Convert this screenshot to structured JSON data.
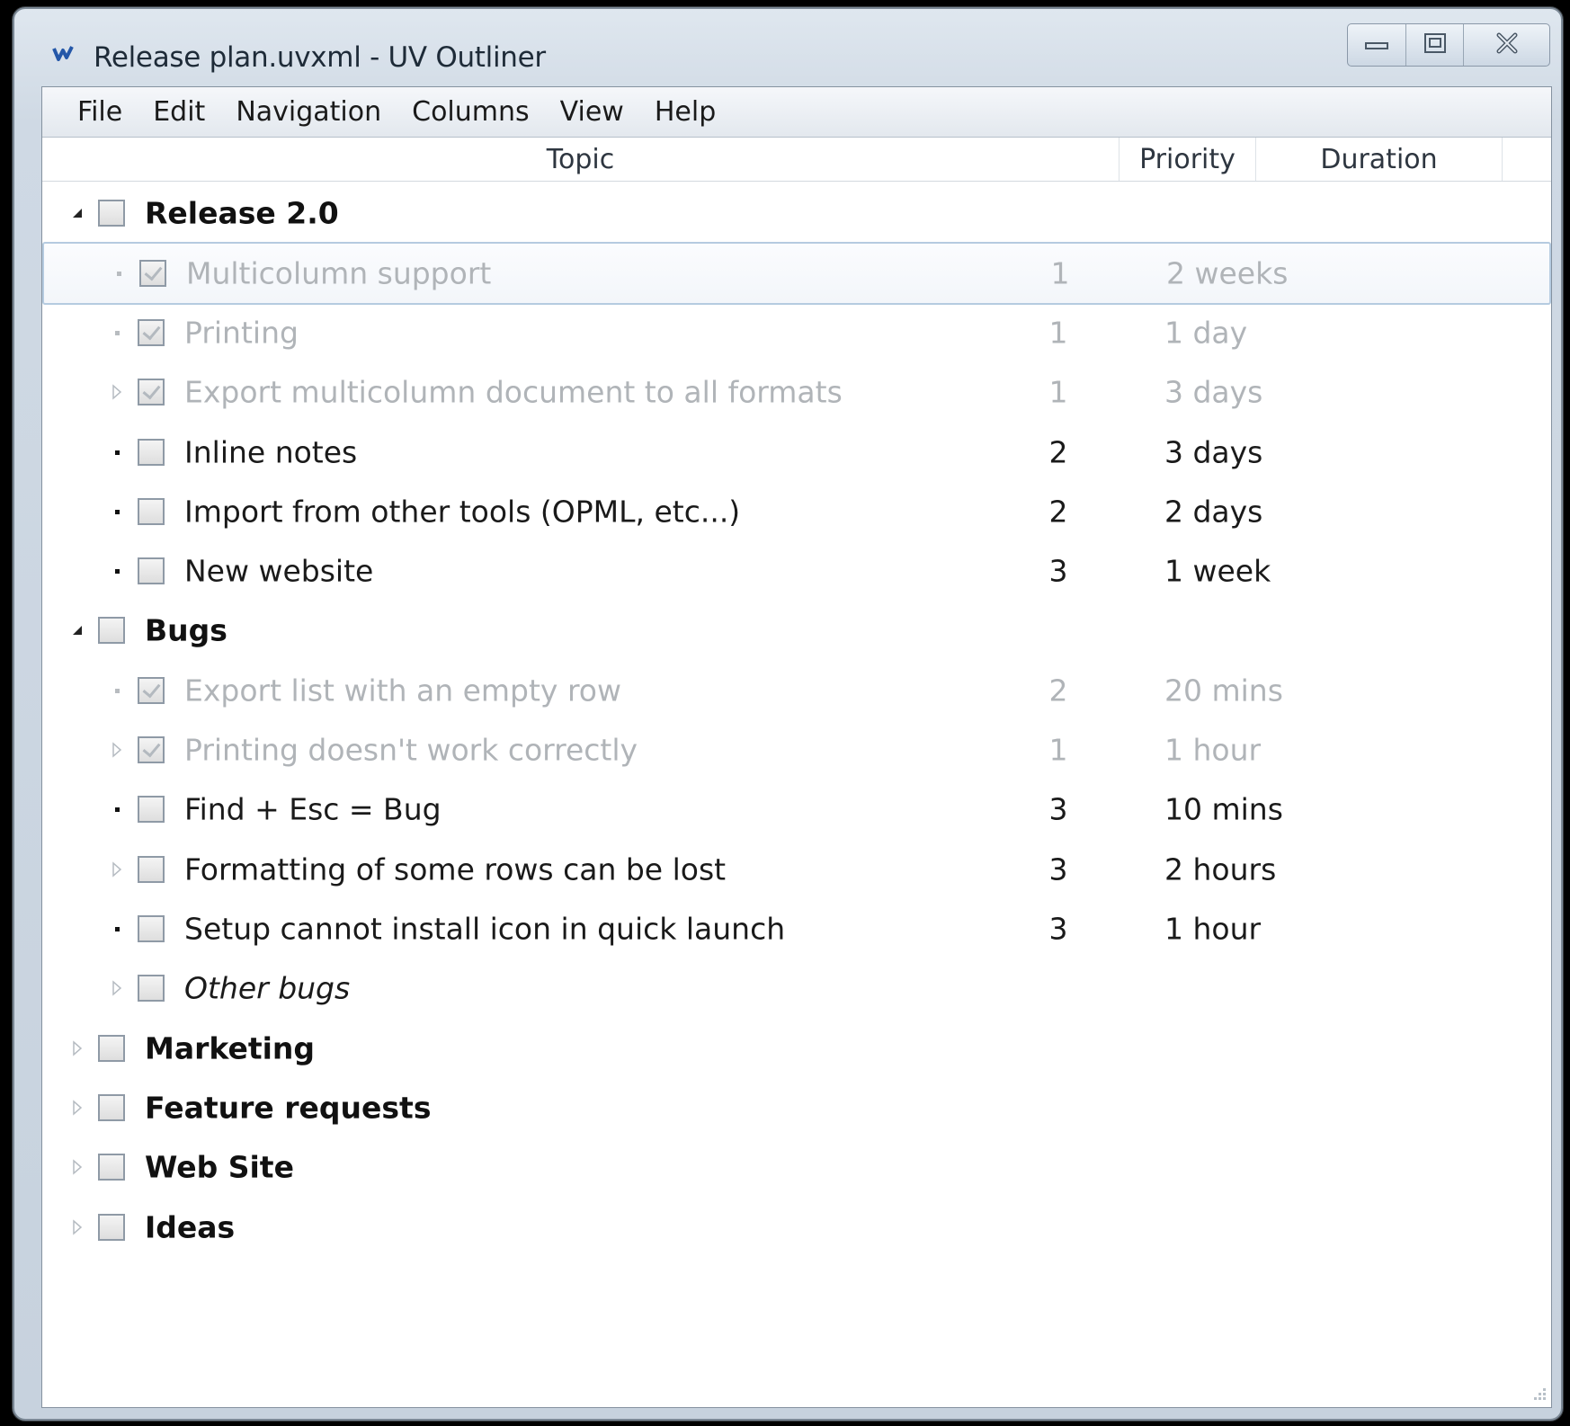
{
  "window": {
    "title": "Release plan.uvxml - UV Outliner"
  },
  "menu": [
    "File",
    "Edit",
    "Navigation",
    "Columns",
    "View",
    "Help"
  ],
  "columns": {
    "topic": "Topic",
    "priority": "Priority",
    "duration": "Duration"
  },
  "rows": [
    {
      "topic": "Release 2.0",
      "priority": "",
      "duration": "",
      "level": 0,
      "expander": "expanded",
      "checked": false,
      "style": "bold"
    },
    {
      "topic": "Multicolumn support",
      "priority": "1",
      "duration": "2 weeks",
      "level": 1,
      "expander": "bullet",
      "checked": true,
      "style": "done",
      "selected": true
    },
    {
      "topic": "Printing",
      "priority": "1",
      "duration": "1 day",
      "level": 1,
      "expander": "bullet",
      "checked": true,
      "style": "done"
    },
    {
      "topic": "Export multicolumn document to all formats",
      "priority": "1",
      "duration": "3 days",
      "level": 1,
      "expander": "collapsed",
      "checked": true,
      "style": "done"
    },
    {
      "topic": "Inline notes",
      "priority": "2",
      "duration": "3 days",
      "level": 1,
      "expander": "bullet",
      "checked": false,
      "style": "normal"
    },
    {
      "topic": "Import from other tools (OPML, etc...)",
      "priority": "2",
      "duration": "2 days",
      "level": 1,
      "expander": "bullet",
      "checked": false,
      "style": "normal"
    },
    {
      "topic": "New website",
      "priority": "3",
      "duration": "1 week",
      "level": 1,
      "expander": "bullet",
      "checked": false,
      "style": "normal"
    },
    {
      "topic": "Bugs",
      "priority": "",
      "duration": "",
      "level": 0,
      "expander": "expanded",
      "checked": false,
      "style": "bold"
    },
    {
      "topic": "Export list with an empty row",
      "priority": "2",
      "duration": "20 mins",
      "level": 1,
      "expander": "bullet",
      "checked": true,
      "style": "done"
    },
    {
      "topic": "Printing doesn't work correctly",
      "priority": "1",
      "duration": "1 hour",
      "level": 1,
      "expander": "collapsed",
      "checked": true,
      "style": "done"
    },
    {
      "topic": "Find + Esc = Bug",
      "priority": "3",
      "duration": "10 mins",
      "level": 1,
      "expander": "bullet",
      "checked": false,
      "style": "normal"
    },
    {
      "topic": "Formatting of some rows can be lost",
      "priority": "3",
      "duration": "2 hours",
      "level": 1,
      "expander": "collapsed",
      "checked": false,
      "style": "normal"
    },
    {
      "topic": "Setup cannot install icon in quick launch",
      "priority": "3",
      "duration": "1 hour",
      "level": 1,
      "expander": "bullet",
      "checked": false,
      "style": "normal"
    },
    {
      "topic": "Other bugs",
      "priority": "",
      "duration": "",
      "level": 1,
      "expander": "collapsed",
      "checked": false,
      "style": "italic"
    },
    {
      "topic": "Marketing",
      "priority": "",
      "duration": "",
      "level": 0,
      "expander": "collapsed",
      "checked": false,
      "style": "bold"
    },
    {
      "topic": "Feature requests",
      "priority": "",
      "duration": "",
      "level": 0,
      "expander": "collapsed",
      "checked": false,
      "style": "bold"
    },
    {
      "topic": "Web Site",
      "priority": "",
      "duration": "",
      "level": 0,
      "expander": "collapsed",
      "checked": false,
      "style": "bold"
    },
    {
      "topic": "Ideas",
      "priority": "",
      "duration": "",
      "level": 0,
      "expander": "collapsed",
      "checked": false,
      "style": "bold"
    }
  ],
  "icons": {
    "app": "uv-outliner-app-icon",
    "minimize": "minimize-icon",
    "maximize": "maximize-icon",
    "close": "close-icon",
    "resize_grip": "resize-grip-icon"
  }
}
